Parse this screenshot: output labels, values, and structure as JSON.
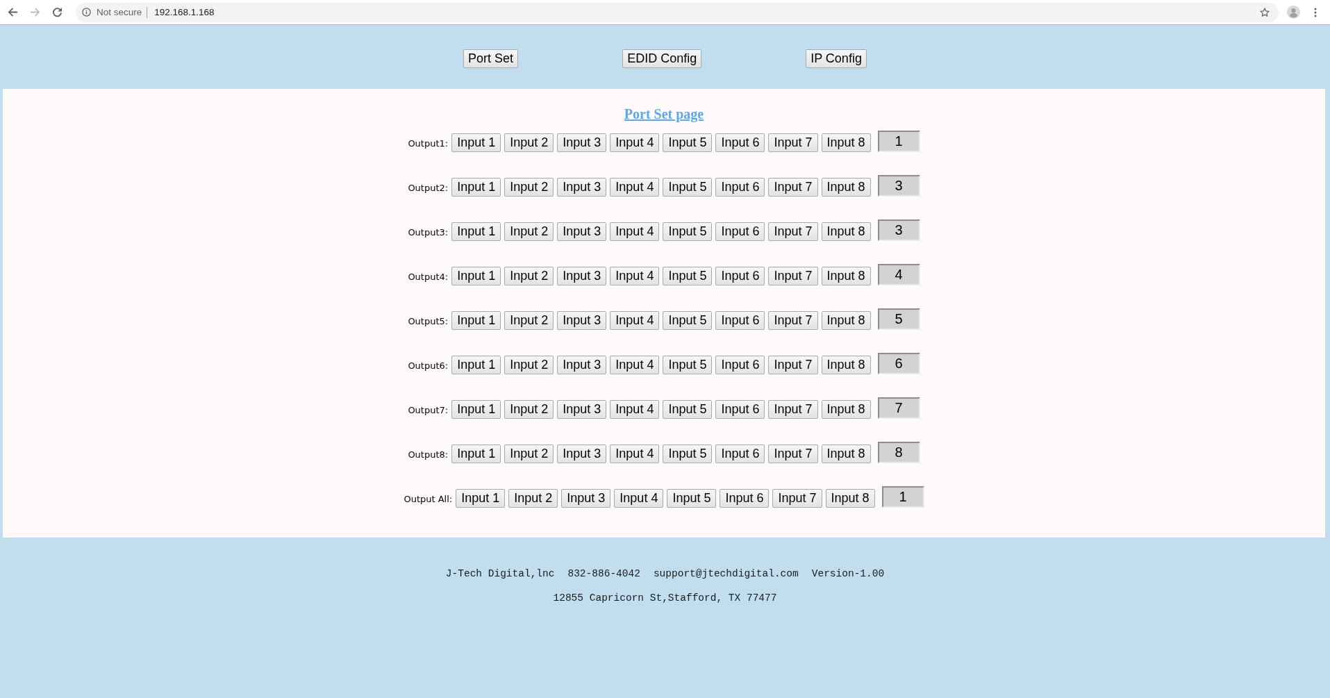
{
  "browser": {
    "security_label": "Not secure",
    "url": "192.168.1.168"
  },
  "nav_buttons": [
    "Port Set",
    "EDID Config",
    "IP Config"
  ],
  "page_title": "Port Set page",
  "outputs": [
    {
      "label": "Output1:",
      "inputs": [
        "Input 1",
        "Input 2",
        "Input 3",
        "Input 4",
        "Input 5",
        "Input 6",
        "Input 7",
        "Input 8"
      ],
      "value": "1"
    },
    {
      "label": "Output2:",
      "inputs": [
        "Input 1",
        "Input 2",
        "Input 3",
        "Input 4",
        "Input 5",
        "Input 6",
        "Input 7",
        "Input 8"
      ],
      "value": "3"
    },
    {
      "label": "Output3:",
      "inputs": [
        "Input 1",
        "Input 2",
        "Input 3",
        "Input 4",
        "Input 5",
        "Input 6",
        "Input 7",
        "Input 8"
      ],
      "value": "3"
    },
    {
      "label": "Output4:",
      "inputs": [
        "Input 1",
        "Input 2",
        "Input 3",
        "Input 4",
        "Input 5",
        "Input 6",
        "Input 7",
        "Input 8"
      ],
      "value": "4"
    },
    {
      "label": "Output5:",
      "inputs": [
        "Input 1",
        "Input 2",
        "Input 3",
        "Input 4",
        "Input 5",
        "Input 6",
        "Input 7",
        "Input 8"
      ],
      "value": "5"
    },
    {
      "label": "Output6:",
      "inputs": [
        "Input 1",
        "Input 2",
        "Input 3",
        "Input 4",
        "Input 5",
        "Input 6",
        "Input 7",
        "Input 8"
      ],
      "value": "6"
    },
    {
      "label": "Output7:",
      "inputs": [
        "Input 1",
        "Input 2",
        "Input 3",
        "Input 4",
        "Input 5",
        "Input 6",
        "Input 7",
        "Input 8"
      ],
      "value": "7"
    },
    {
      "label": "Output8:",
      "inputs": [
        "Input 1",
        "Input 2",
        "Input 3",
        "Input 4",
        "Input 5",
        "Input 6",
        "Input 7",
        "Input 8"
      ],
      "value": "8"
    },
    {
      "label": "Output All:",
      "inputs": [
        "Input 1",
        "Input 2",
        "Input 3",
        "Input 4",
        "Input 5",
        "Input 6",
        "Input 7",
        "Input 8"
      ],
      "value": "1"
    }
  ],
  "footer": {
    "line_1": [
      "J-Tech Digital,lnc",
      "832-886-4042",
      "support@jtechdigital.com",
      "Version-1.00"
    ],
    "line_2": "12855 Capricorn St,Stafford, TX 77477"
  }
}
